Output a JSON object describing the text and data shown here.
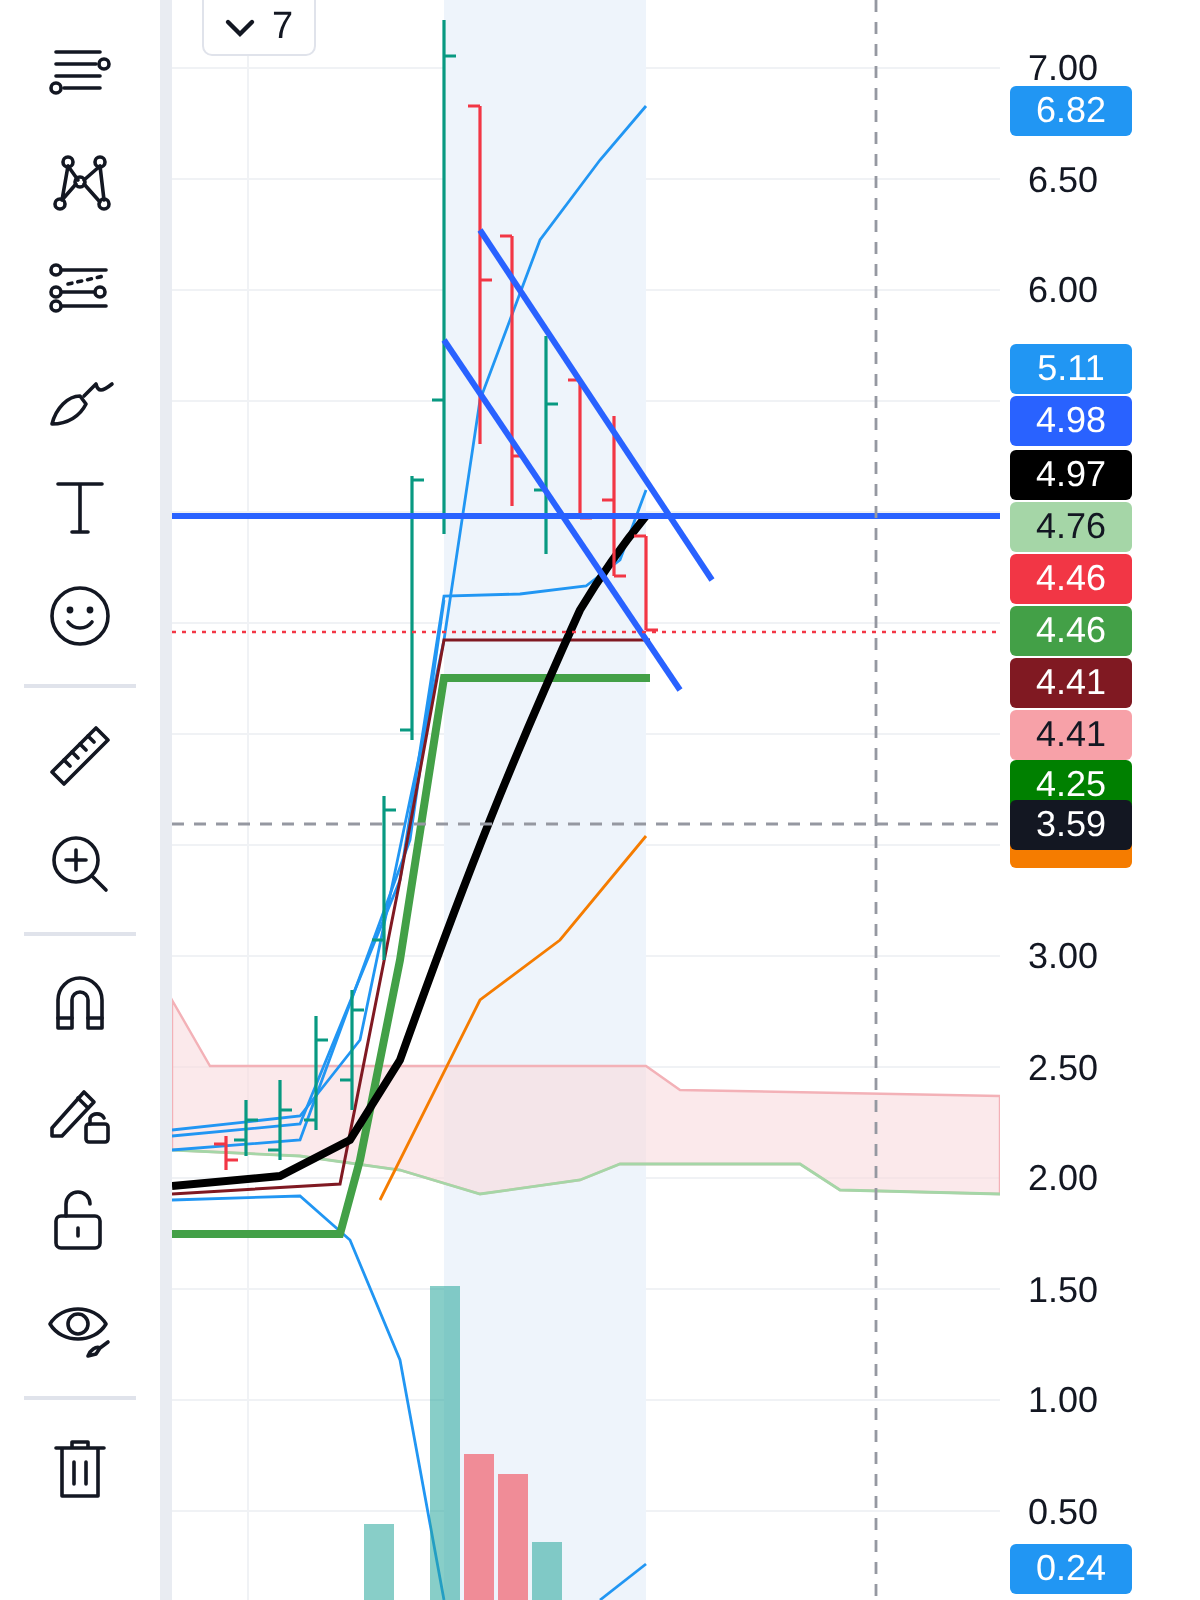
{
  "collapse_button": {
    "label": "7"
  },
  "price_axis": {
    "ticks": [
      "7.00",
      "6.50",
      "6.00",
      "3.00",
      "2.50",
      "2.00",
      "1.50",
      "1.00",
      "0.50"
    ],
    "badges": [
      {
        "text": "6.82",
        "color": "#2196f3"
      },
      {
        "text": "5.11",
        "color": "#2196f3"
      },
      {
        "text": "4.98",
        "color": "#2962ff"
      },
      {
        "text": "4.97",
        "color": "#000000"
      },
      {
        "text": "4.76",
        "color": "#a5d6a7"
      },
      {
        "text": "4.46",
        "color": "#f23645"
      },
      {
        "text": "4.46",
        "color": "#43a047"
      },
      {
        "text": "4.41",
        "color": "#801922"
      },
      {
        "text": "4.41",
        "color": "#f7a1a8"
      },
      {
        "text": "4.25",
        "color": "#008000"
      },
      {
        "text": "3.59",
        "color": "#131722"
      },
      {
        "text": "0.24",
        "color": "#2196f3"
      }
    ]
  }
}
